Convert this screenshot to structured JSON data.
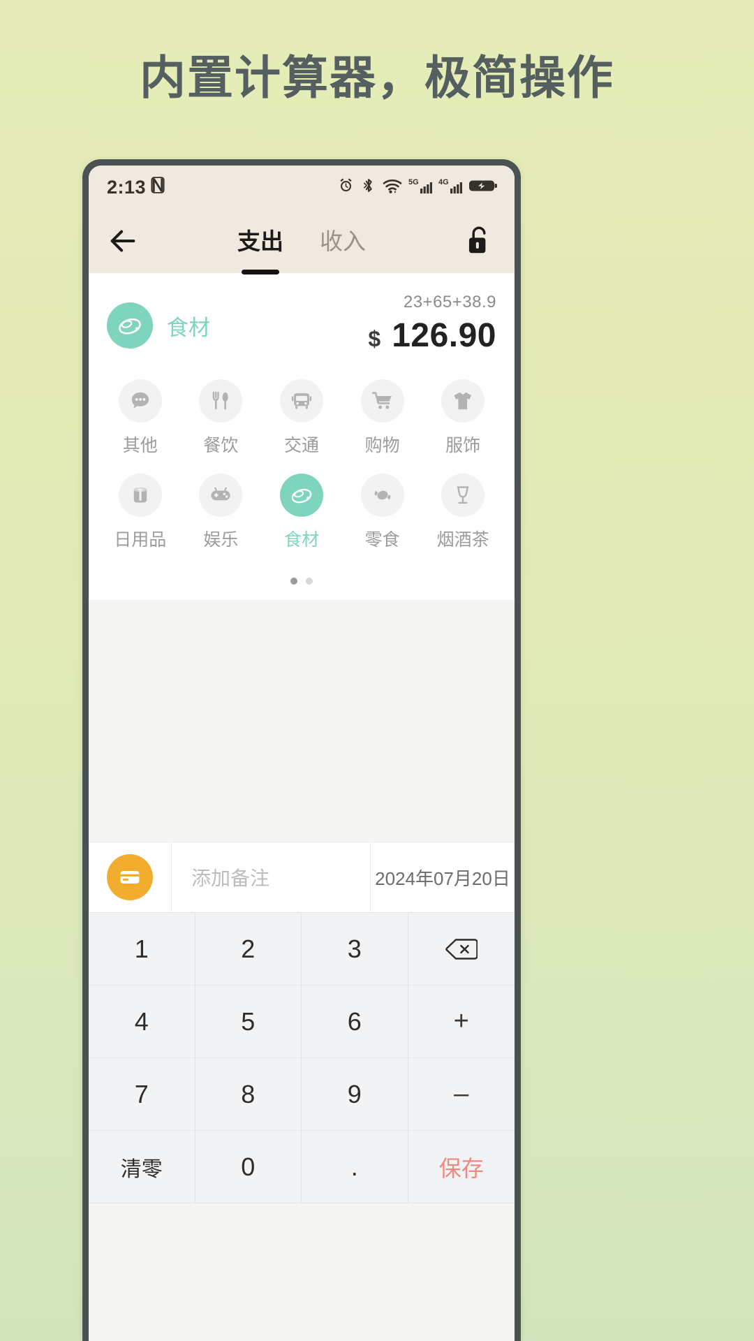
{
  "headline": "内置计算器，极简操作",
  "statusbar": {
    "time": "2:13",
    "icons": [
      "nfc-icon",
      "alarm-icon",
      "bluetooth-icon",
      "wifi-icon",
      "5g-icon",
      "signal-icon",
      "4g-icon",
      "signal2-icon",
      "battery-charging-icon"
    ],
    "network_5g": "5G",
    "network_4g": "4G"
  },
  "navbar": {
    "back": "back-arrow-icon",
    "tabs": [
      {
        "label": "支出",
        "active": true
      },
      {
        "label": "收入",
        "active": false
      }
    ],
    "lock": "lock-open-icon"
  },
  "entry": {
    "category_name": "食材",
    "category_icon": "food-ingredient-icon",
    "formula": "23+65+38.9",
    "currency": "$",
    "amount": "126.90"
  },
  "categories": {
    "page_dots": 2,
    "active_dot": 0,
    "items": [
      {
        "label": "其他",
        "icon": "dots-bubble-icon",
        "selected": false
      },
      {
        "label": "餐饮",
        "icon": "fork-knife-icon",
        "selected": false
      },
      {
        "label": "交通",
        "icon": "bus-icon",
        "selected": false
      },
      {
        "label": "购物",
        "icon": "shopping-cart-icon",
        "selected": false
      },
      {
        "label": "服饰",
        "icon": "tshirt-icon",
        "selected": false
      },
      {
        "label": "日用品",
        "icon": "toilet-paper-icon",
        "selected": false
      },
      {
        "label": "娱乐",
        "icon": "gamepad-icon",
        "selected": false
      },
      {
        "label": "食材",
        "icon": "food-ingredient-icon",
        "selected": true
      },
      {
        "label": "零食",
        "icon": "candy-icon",
        "selected": false
      },
      {
        "label": "烟酒茶",
        "icon": "wine-glass-icon",
        "selected": false
      }
    ]
  },
  "note_row": {
    "account_icon": "wallet-card-icon",
    "note_placeholder": "添加备注",
    "note_value": "",
    "date": "2024年07月20日"
  },
  "keypad": {
    "keys": [
      {
        "label": "1",
        "name": "key-1",
        "type": "digit"
      },
      {
        "label": "2",
        "name": "key-2",
        "type": "digit"
      },
      {
        "label": "3",
        "name": "key-3",
        "type": "digit"
      },
      {
        "label": "",
        "name": "key-backspace",
        "type": "backspace"
      },
      {
        "label": "4",
        "name": "key-4",
        "type": "digit"
      },
      {
        "label": "5",
        "name": "key-5",
        "type": "digit"
      },
      {
        "label": "6",
        "name": "key-6",
        "type": "digit"
      },
      {
        "label": "+",
        "name": "key-plus",
        "type": "op"
      },
      {
        "label": "7",
        "name": "key-7",
        "type": "digit"
      },
      {
        "label": "8",
        "name": "key-8",
        "type": "digit"
      },
      {
        "label": "9",
        "name": "key-9",
        "type": "digit"
      },
      {
        "label": "–",
        "name": "key-minus",
        "type": "op"
      },
      {
        "label": "清零",
        "name": "key-clear",
        "type": "clear"
      },
      {
        "label": "0",
        "name": "key-0",
        "type": "digit"
      },
      {
        "label": ".",
        "name": "key-dot",
        "type": "digit"
      },
      {
        "label": "保存",
        "name": "key-save",
        "type": "save"
      }
    ]
  },
  "colors": {
    "accent_mint": "#7fd4bd",
    "save_red": "#f08a80",
    "wallet_orange": "#f3ad2e",
    "bg_green": "#e3eab6",
    "headline_gray": "#565f5f"
  }
}
